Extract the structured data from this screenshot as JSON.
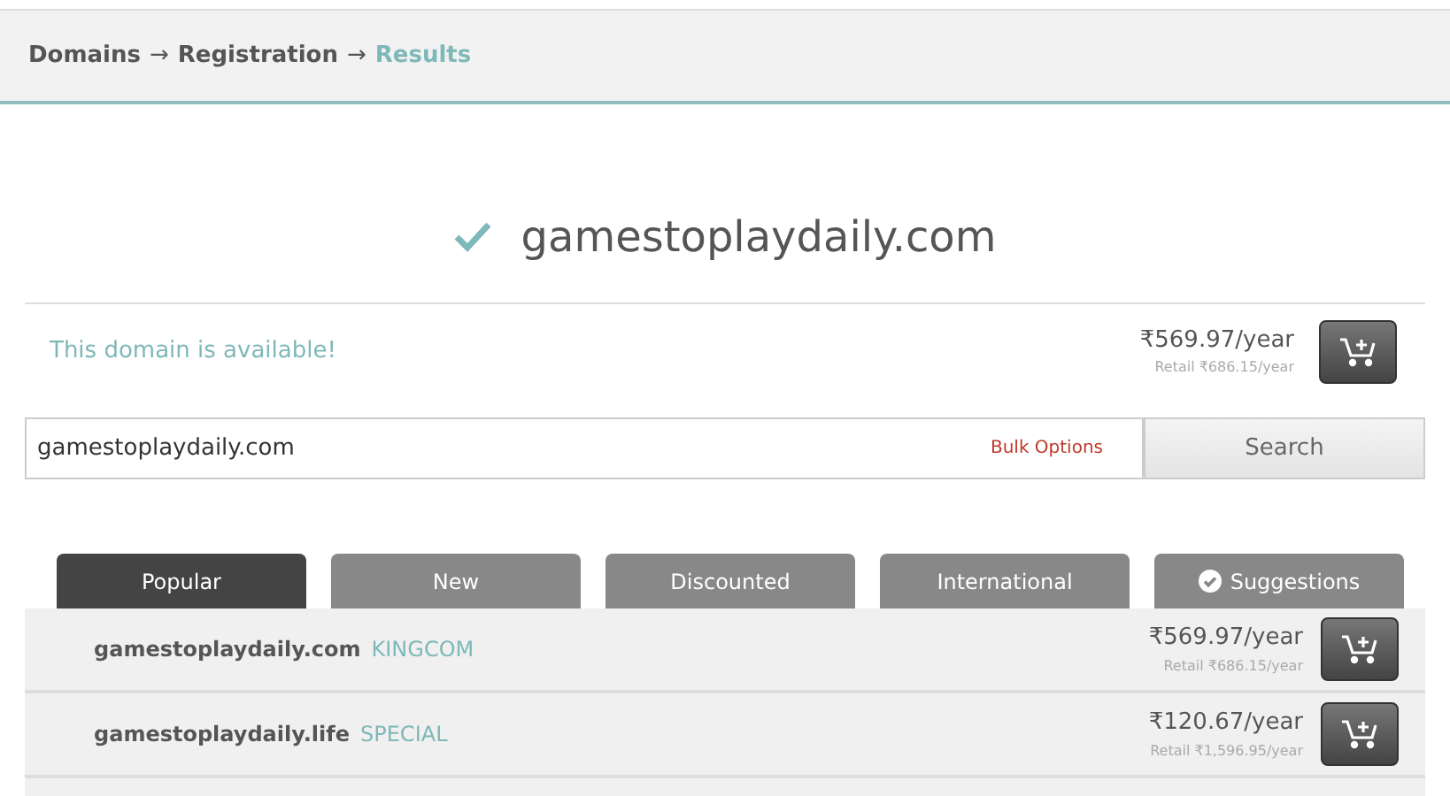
{
  "breadcrumb": [
    {
      "label": "Domains",
      "selected": false
    },
    {
      "label": "→",
      "kind": "arrow"
    },
    {
      "label": "Registration",
      "selected": false
    },
    {
      "label": "→",
      "kind": "arrow"
    },
    {
      "label": "Results",
      "selected": true
    }
  ],
  "result": {
    "domain": "gamestoplaydaily.com",
    "available": true,
    "message": "This domain is available!",
    "price": "₹569.97/year",
    "retail": "Retail ₹686.15/year"
  },
  "search": {
    "value": "gamestoplaydaily.com",
    "bulk_options": "Bulk Options",
    "button": "Search"
  },
  "tabs": [
    {
      "label": "Popular",
      "selected": true,
      "kind": "plain"
    },
    {
      "label": "New",
      "selected": false,
      "kind": "plain"
    },
    {
      "label": "Discounted",
      "selected": false,
      "kind": "plain"
    },
    {
      "label": "International",
      "selected": false,
      "kind": "plain"
    },
    {
      "label": "Suggestions",
      "selected": false,
      "kind": "check"
    }
  ],
  "rows": [
    {
      "domain": "gamestoplaydaily.com",
      "tag": "KINGCOM",
      "price": "₹569.97/year",
      "retail": "Retail ₹686.15/year"
    },
    {
      "domain": "gamestoplaydaily.life",
      "tag": "SPECIAL",
      "price": "₹120.67/year",
      "retail": "Retail ₹1,596.95/year"
    }
  ]
}
